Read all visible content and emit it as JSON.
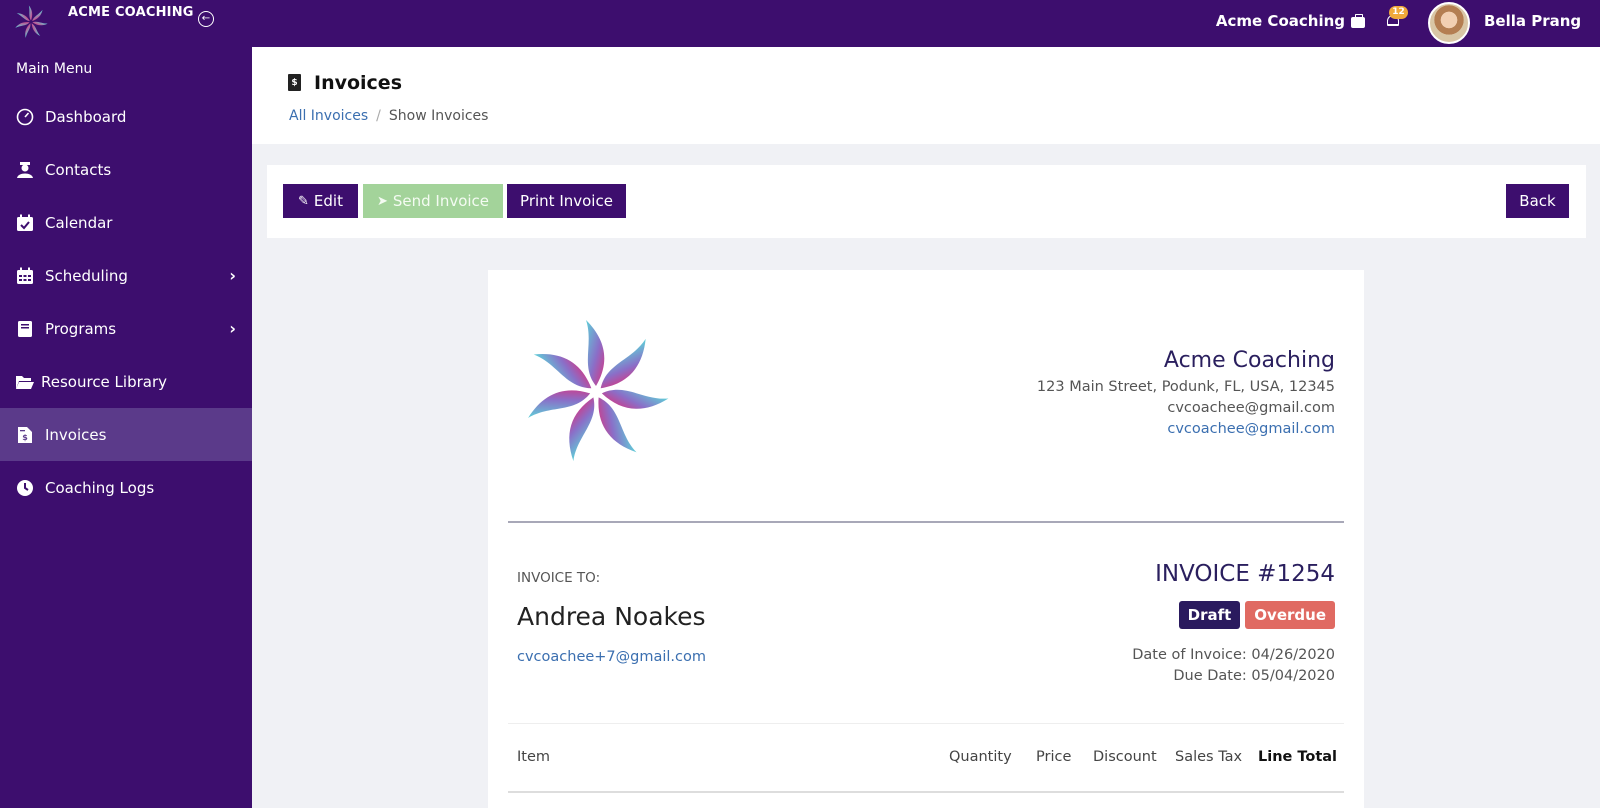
{
  "app": {
    "brand_name": "ACME COACHING",
    "org_name": "Acme Coaching",
    "notification_count": "12",
    "user_name": "Bella Prang"
  },
  "sidebar": {
    "title": "Main Menu",
    "items": [
      {
        "label": "Dashboard",
        "icon": "dashboard-gauge-icon"
      },
      {
        "label": "Contacts",
        "icon": "contacts-user-icon"
      },
      {
        "label": "Calendar",
        "icon": "calendar-check-icon"
      },
      {
        "label": "Scheduling",
        "icon": "calendar-grid-icon",
        "has_submenu": true
      },
      {
        "label": "Programs",
        "icon": "book-icon",
        "has_submenu": true
      },
      {
        "label": "Resource Library",
        "icon": "folder-open-icon"
      },
      {
        "label": "Invoices",
        "icon": "invoice-file-icon",
        "active": true
      },
      {
        "label": "Coaching Logs",
        "icon": "clock-icon"
      }
    ]
  },
  "header": {
    "title": "Invoices",
    "breadcrumb": {
      "link": "All Invoices",
      "separator": "/",
      "current": "Show Invoices"
    }
  },
  "toolbar": {
    "edit_label": "Edit",
    "send_label": "Send Invoice",
    "print_label": "Print Invoice",
    "back_label": "Back"
  },
  "invoice": {
    "company": {
      "name": "Acme Coaching",
      "address": "123 Main Street, Podunk, FL, USA, 12345",
      "email": "cvcoachee@gmail.com",
      "email_link": "cvcoachee@gmail.com"
    },
    "to_label": "INVOICE TO:",
    "client_name": "Andrea Noakes",
    "client_email": "cvcoachee+7@gmail.com",
    "number": "INVOICE #1254",
    "status_badges": [
      "Draft",
      "Overdue"
    ],
    "date_of_invoice": "Date of Invoice: 04/26/2020",
    "due_date": "Due Date: 05/04/2020",
    "table_headers": [
      "Item",
      "Quantity",
      "Price",
      "Discount",
      "Sales Tax",
      "Line Total"
    ]
  },
  "colors": {
    "brand_purple": "#3d0e6e",
    "sidebar_active": "#5b3a8a",
    "link_blue": "#3b6fb0",
    "draft_badge": "#2a1a5e",
    "overdue_badge": "#e06a62",
    "send_disabled": "#a3d39a",
    "notification_badge": "#f0a93a"
  }
}
